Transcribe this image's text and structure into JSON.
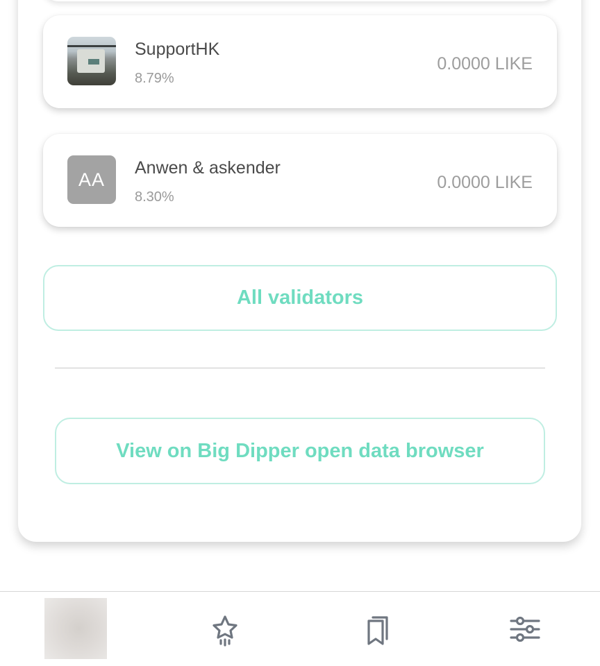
{
  "validators": [
    {
      "name": "SupportHK",
      "percentage": "8.79%",
      "amount": "0.0000 LIKE",
      "avatar": "photo"
    },
    {
      "name": "Anwen & askender",
      "percentage": "8.30%",
      "amount": "0.0000 LIKE",
      "avatar_initials": "AA"
    }
  ],
  "buttons": {
    "all_validators": "All validators",
    "big_dipper": "View on Big Dipper open data browser"
  },
  "bottom_nav": {
    "items": [
      "profile-avatar",
      "star-icon",
      "bookmarks-icon",
      "settings-sliders-icon"
    ]
  },
  "colors": {
    "accent": "#6fdcc0",
    "accent_border": "#bfeee2",
    "avatar_gray": "#a3a3a3",
    "icon_gray": "#6f7680"
  }
}
